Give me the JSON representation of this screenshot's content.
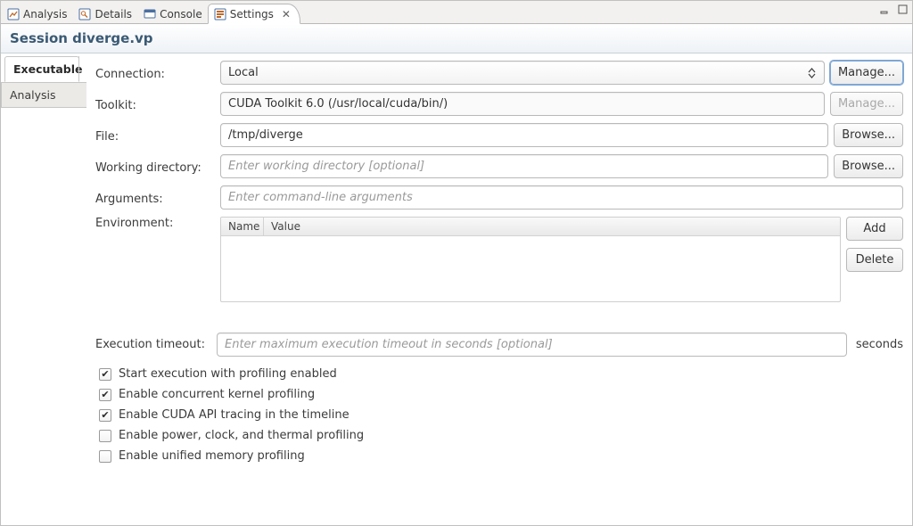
{
  "tabs": {
    "items": [
      {
        "label": "Analysis",
        "icon": "analysis"
      },
      {
        "label": "Details",
        "icon": "details"
      },
      {
        "label": "Console",
        "icon": "console"
      },
      {
        "label": "Settings",
        "icon": "session"
      }
    ],
    "active_index": 3
  },
  "session_title": "Session diverge.vp",
  "sidebar": {
    "items": [
      {
        "label": "Executable"
      },
      {
        "label": "Analysis"
      }
    ],
    "active_index": 0
  },
  "form": {
    "connection": {
      "label": "Connection:",
      "value": "Local",
      "manage": "Manage..."
    },
    "toolkit": {
      "label": "Toolkit:",
      "value": "CUDA Toolkit 6.0 (/usr/local/cuda/bin/)",
      "manage": "Manage..."
    },
    "file": {
      "label": "File:",
      "value": "/tmp/diverge",
      "browse": "Browse..."
    },
    "workdir": {
      "label": "Working directory:",
      "placeholder": "Enter working directory [optional]",
      "browse": "Browse..."
    },
    "arguments": {
      "label": "Arguments:",
      "placeholder": "Enter command-line arguments"
    },
    "environment": {
      "label": "Environment:",
      "col_name": "Name",
      "col_value": "Value",
      "add": "Add",
      "delete": "Delete",
      "rows": []
    },
    "timeout": {
      "label": "Execution timeout:",
      "placeholder": "Enter maximum execution timeout in seconds [optional]",
      "unit": "seconds"
    },
    "checks": [
      {
        "label": "Start execution with profiling enabled",
        "checked": true
      },
      {
        "label": "Enable concurrent kernel profiling",
        "checked": true
      },
      {
        "label": "Enable CUDA API tracing in the timeline",
        "checked": true
      },
      {
        "label": "Enable power, clock, and thermal profiling",
        "checked": false
      },
      {
        "label": "Enable unified memory profiling",
        "checked": false
      }
    ]
  }
}
